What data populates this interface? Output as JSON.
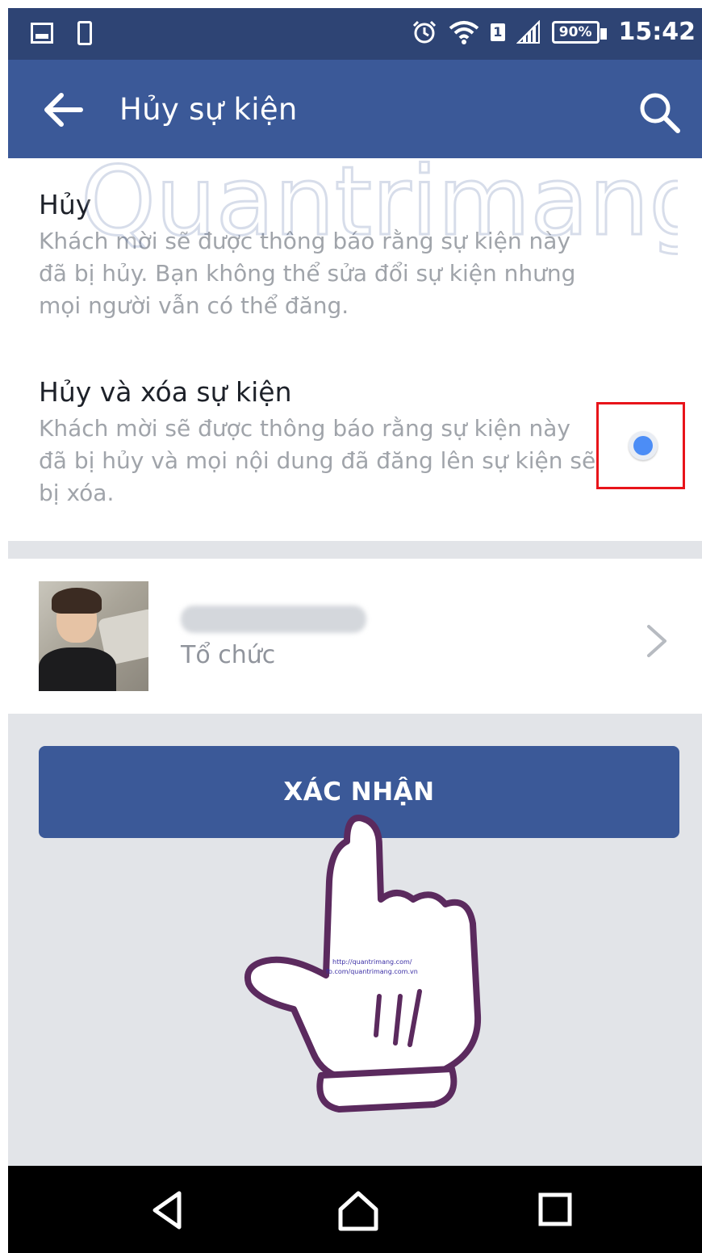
{
  "status_bar": {
    "battery": "90%",
    "time": "15:42"
  },
  "app_bar": {
    "title": "Hủy sự kiện"
  },
  "options": [
    {
      "title": "Hủy",
      "description": "Khách mời sẽ được thông báo rằng sự kiện này đã bị hủy. Bạn không thể sửa đổi sự kiện nhưng mọi người vẫn có thể đăng."
    },
    {
      "title": "Hủy và xóa sự kiện",
      "description": "Khách mời sẽ được thông báo rằng sự kiện này đã bị hủy và mọi nội dung đã đăng lên sự kiện sẽ bị xóa.",
      "selected": true
    }
  ],
  "organizer": {
    "role": "Tổ chức"
  },
  "confirm_button": {
    "label": "XÁC NHẬN"
  },
  "overlay": {
    "watermark": "Quantrimang",
    "hand_caption_line1": "http://quantrimang.com/",
    "hand_caption_line2": "fb.com/quantrimang.com.vn"
  },
  "colors": {
    "header": "#3b5998",
    "status_bar": "#2e4474",
    "radio_selected": "#4c8df6",
    "highlight_box": "#e8141a"
  },
  "icons": [
    "gallery-icon",
    "phone-icon",
    "alarm-icon",
    "wifi-icon",
    "sim-icon",
    "signal-icon",
    "battery-icon",
    "back-arrow-icon",
    "search-icon",
    "chevron-right-icon",
    "nav-back-icon",
    "nav-home-icon",
    "nav-recents-icon"
  ]
}
